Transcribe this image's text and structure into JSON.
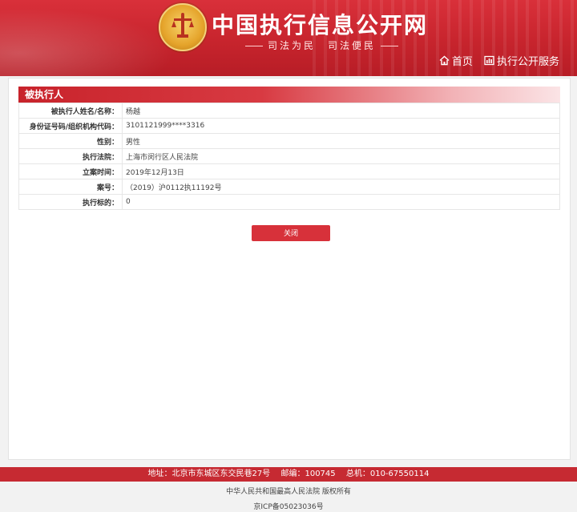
{
  "header": {
    "site_title": "中国执行信息公开网",
    "slogan": "司法为民　司法便民",
    "nav": {
      "home": "首页",
      "service": "执行公开服务"
    }
  },
  "panel": {
    "title": "被执行人",
    "rows": [
      {
        "label": "被执行人姓名/名称：",
        "value": "杨越"
      },
      {
        "label": "身份证号码/组织机构代码：",
        "value": "3101121999****3316"
      },
      {
        "label": "性别：",
        "value": "男性"
      },
      {
        "label": "执行法院：",
        "value": "上海市闵行区人民法院"
      },
      {
        "label": "立案时间：",
        "value": "2019年12月13日"
      },
      {
        "label": "案号：",
        "value": "（2019）沪0112执11192号"
      },
      {
        "label": "执行标的：",
        "value": "0"
      }
    ],
    "close_label": "关闭"
  },
  "footer": {
    "address": "地址：北京市东城区东交民巷27号",
    "postcode": "邮编：100745",
    "phone": "总机：010-67550114",
    "copyright": "中华人民共和国最高人民法院 版权所有",
    "icp": "京ICP备05023036号"
  },
  "colors": {
    "brand_red": "#c7242d",
    "button_red": "#d7313a"
  },
  "icons": {
    "emblem": "court-emblem-icon",
    "home": "home-icon",
    "service": "service-icon"
  }
}
